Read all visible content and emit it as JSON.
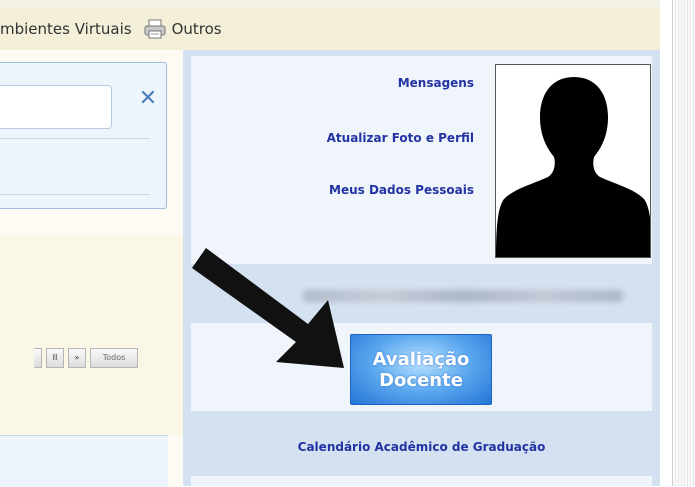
{
  "menu": {
    "ambientes_label": "mbientes Virtuais",
    "outros_label": "Outros",
    "outros_icon": "printer-icon"
  },
  "search": {
    "value": "",
    "clear_icon": "close-icon",
    "clear_glyph": "✕"
  },
  "pager": {
    "buttons": [
      "",
      "II",
      "»",
      "Todos"
    ]
  },
  "profile": {
    "links": [
      "Mensagens",
      "Atualizar Foto e Perfil",
      "Meus Dados Pessoais"
    ],
    "photo_icon": "user-silhouette-icon"
  },
  "evaluation": {
    "line1": "Avaliação",
    "line2": "Docente"
  },
  "calendar": {
    "label": "Calendário Acadêmico de Graduação"
  },
  "annotation": {
    "arrow_icon": "arrow-pointer-icon"
  },
  "colors": {
    "link": "#2233a3",
    "panel": "#d3e1f1",
    "button": "#2474d6"
  }
}
